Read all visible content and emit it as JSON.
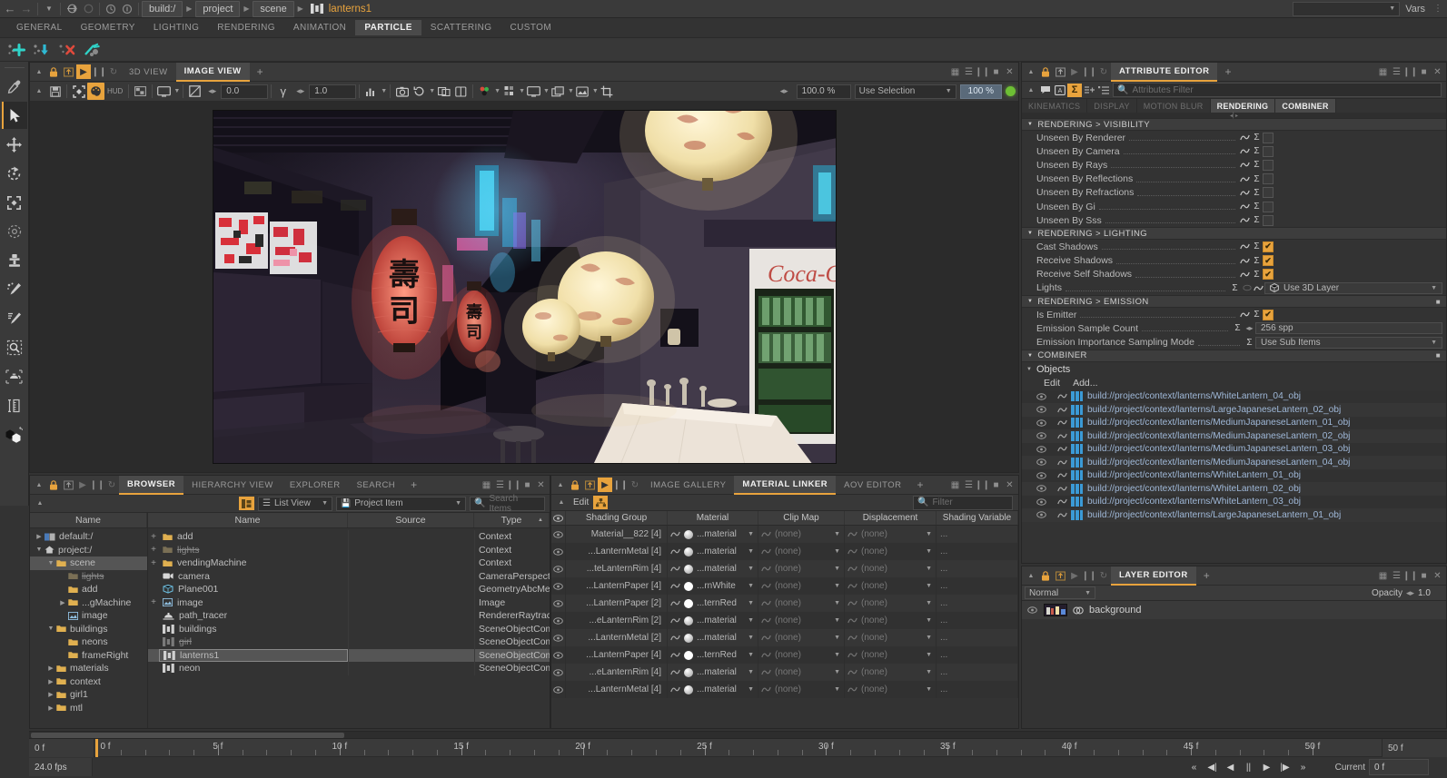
{
  "topbar": {
    "back_icon": "arrow-left-icon",
    "forward_icon": "arrow-right-icon",
    "history_icon": "chevron-down-icon",
    "crumbs": [
      {
        "label": "build:/"
      },
      {
        "label": "project"
      },
      {
        "label": "scene"
      }
    ],
    "active_item": "lanterns1",
    "vars_label": "Vars"
  },
  "menubar": {
    "items": [
      {
        "label": "GENERAL",
        "active": false
      },
      {
        "label": "GEOMETRY",
        "active": false
      },
      {
        "label": "LIGHTING",
        "active": false
      },
      {
        "label": "RENDERING",
        "active": false
      },
      {
        "label": "ANIMATION",
        "active": false
      },
      {
        "label": "PARTICLE",
        "active": true
      },
      {
        "label": "SCATTERING",
        "active": false
      },
      {
        "label": "CUSTOM",
        "active": false
      }
    ]
  },
  "particle_toolbar": {
    "buttons": [
      {
        "name": "add-particle-icon"
      },
      {
        "name": "import-particle-icon"
      },
      {
        "name": "delete-particle-icon"
      },
      {
        "name": "link-particle-icon"
      }
    ]
  },
  "left_tools": {
    "items": [
      {
        "name": "eyedropper-tool",
        "selected": false
      },
      {
        "name": "select-arrow-tool",
        "selected": true
      },
      {
        "name": "move-tool",
        "selected": false
      },
      {
        "name": "rotate-tool",
        "selected": false
      },
      {
        "name": "scale-tool",
        "selected": false
      },
      {
        "name": "soft-select-tool",
        "selected": false
      },
      {
        "name": "clone-stamp-tool",
        "selected": false
      },
      {
        "name": "particle-brush-tool",
        "selected": false
      },
      {
        "name": "paint-brush-tool",
        "selected": false
      },
      {
        "name": "region-render-tool",
        "selected": false
      },
      {
        "name": "teapot-primitive-tool",
        "selected": false
      },
      {
        "name": "measure-tool",
        "selected": false
      },
      {
        "name": "color-swatch-tool",
        "selected": false
      }
    ]
  },
  "viewport": {
    "tabs": [
      {
        "label": "3D VIEW",
        "active": false
      },
      {
        "label": "IMAGE VIEW",
        "active": true
      }
    ],
    "add_tab": "+",
    "toolbar": {
      "hud_label": "HUD",
      "exposure_value": "0.0",
      "gamma_value": "1.0",
      "zoom_value": "100.0 %",
      "selection_mode": "Use Selection",
      "zoom_badge": "100 %"
    },
    "scene_description": "Night alley 3D render with red sushi lanterns and white paper lanterns"
  },
  "browser": {
    "tabs": [
      {
        "label": "BROWSER",
        "active": true
      },
      {
        "label": "HIERARCHY VIEW",
        "active": false
      },
      {
        "label": "EXPLORER",
        "active": false
      },
      {
        "label": "SEARCH",
        "active": false
      }
    ],
    "add_tab": "+",
    "view_mode": "List View",
    "filter_mode": "Project Item",
    "search_placeholder": "Search Items",
    "tree_header": "Name",
    "tree": [
      {
        "label": "default:/",
        "depth": 0,
        "twisty": "▶",
        "icon": "book-icon",
        "selected": false,
        "disabled": false
      },
      {
        "label": "project:/",
        "depth": 0,
        "twisty": "▼",
        "icon": "home-icon",
        "selected": false,
        "disabled": false
      },
      {
        "label": "scene",
        "depth": 1,
        "twisty": "▼",
        "icon": "folder-icon",
        "selected": true,
        "disabled": false
      },
      {
        "label": "lights",
        "depth": 2,
        "twisty": "",
        "icon": "folder-icon",
        "selected": false,
        "disabled": true
      },
      {
        "label": "add",
        "depth": 2,
        "twisty": "",
        "icon": "folder-icon",
        "selected": false,
        "disabled": false
      },
      {
        "label": "...gMachine",
        "depth": 2,
        "twisty": "▶",
        "icon": "folder-icon",
        "selected": false,
        "disabled": false
      },
      {
        "label": "image",
        "depth": 2,
        "twisty": "",
        "icon": "image-icon",
        "selected": false,
        "disabled": false
      },
      {
        "label": "buildings",
        "depth": 1,
        "twisty": "▼",
        "icon": "folder-icon",
        "selected": false,
        "disabled": false
      },
      {
        "label": "neons",
        "depth": 2,
        "twisty": "",
        "icon": "folder-icon",
        "selected": false,
        "disabled": false
      },
      {
        "label": "frameRight",
        "depth": 2,
        "twisty": "",
        "icon": "folder-icon",
        "selected": false,
        "disabled": false
      },
      {
        "label": "materials",
        "depth": 1,
        "twisty": "▶",
        "icon": "folder-icon",
        "selected": false,
        "disabled": false
      },
      {
        "label": "context",
        "depth": 1,
        "twisty": "▶",
        "icon": "folder-icon",
        "selected": false,
        "disabled": false
      },
      {
        "label": "girl1",
        "depth": 1,
        "twisty": "▶",
        "icon": "folder-icon",
        "selected": false,
        "disabled": false
      },
      {
        "label": "mtl",
        "depth": 1,
        "twisty": "▶",
        "icon": "folder-icon",
        "selected": false,
        "disabled": false
      }
    ],
    "list_headers": [
      "Name",
      "Source",
      "Type"
    ],
    "list": [
      {
        "expand": "+",
        "name": "add",
        "icon": "folder-icon",
        "source": "",
        "type": "Context",
        "selected": false,
        "disabled": false
      },
      {
        "expand": "+",
        "name": "lights",
        "icon": "folder-icon",
        "source": "",
        "type": "Context",
        "selected": false,
        "disabled": true
      },
      {
        "expand": "+",
        "name": "vendingMachine",
        "icon": "folder-icon",
        "source": "",
        "type": "Context",
        "selected": false,
        "disabled": false
      },
      {
        "expand": "",
        "name": "camera",
        "icon": "camera-icon",
        "source": "",
        "type": "CameraPerspective",
        "selected": false,
        "disabled": false
      },
      {
        "expand": "",
        "name": "Plane001",
        "icon": "mesh-icon",
        "source": "",
        "type": "GeometryAbcMesh",
        "selected": false,
        "disabled": false
      },
      {
        "expand": "+",
        "name": "image",
        "icon": "image-icon",
        "source": "",
        "type": "Image",
        "selected": false,
        "disabled": false
      },
      {
        "expand": "",
        "name": "path_tracer",
        "icon": "renderer-icon",
        "source": "",
        "type": "RendererRaytracer",
        "selected": false,
        "disabled": false
      },
      {
        "expand": "",
        "name": "buildings",
        "icon": "sceneobject-icon",
        "source": "",
        "type": "SceneObjectComb",
        "selected": false,
        "disabled": false
      },
      {
        "expand": "",
        "name": "girl",
        "icon": "sceneobject-icon",
        "source": "",
        "type": "SceneObjectComb",
        "selected": false,
        "disabled": true
      },
      {
        "expand": "",
        "name": "lanterns1",
        "icon": "sceneobject-icon",
        "source": "",
        "type": "SceneObjectComb",
        "selected": true,
        "disabled": false
      },
      {
        "expand": "",
        "name": "neon",
        "icon": "sceneobject-icon",
        "source": "",
        "type": "SceneObjectComb",
        "selected": false,
        "disabled": false
      }
    ]
  },
  "material_linker": {
    "tabs": [
      {
        "label": "IMAGE GALLERY",
        "active": false
      },
      {
        "label": "MATERIAL LINKER",
        "active": true
      },
      {
        "label": "AOV EDITOR",
        "active": false
      }
    ],
    "add_tab": "+",
    "edit_label": "Edit",
    "filter_placeholder": "Filter",
    "headers": [
      "Shading Group",
      "Material",
      "Clip Map",
      "Displacement",
      "Shading Variable"
    ],
    "rows": [
      {
        "group": "Material__822 [4]",
        "material": "...material",
        "swatch": "#9a9a9a",
        "clip_map": "(none)",
        "displacement": "(none)",
        "shading_variable": "..."
      },
      {
        "group": "...LanternMetal [4]",
        "material": "...material",
        "swatch": "#9a9a9a",
        "clip_map": "(none)",
        "displacement": "(none)",
        "shading_variable": "..."
      },
      {
        "group": "...teLanternRim [4]",
        "material": "...material",
        "swatch": "#9a9a9a",
        "clip_map": "(none)",
        "displacement": "(none)",
        "shading_variable": "..."
      },
      {
        "group": "...LanternPaper [4]",
        "material": "...rnWhite",
        "swatch": "#ffffff",
        "clip_map": "(none)",
        "displacement": "(none)",
        "shading_variable": "..."
      },
      {
        "group": "...LanternPaper [2]",
        "material": "...ternRed",
        "swatch": "#ffffff",
        "clip_map": "(none)",
        "displacement": "(none)",
        "shading_variable": "..."
      },
      {
        "group": "...eLanternRim [2]",
        "material": "...material",
        "swatch": "#9a9a9a",
        "clip_map": "(none)",
        "displacement": "(none)",
        "shading_variable": "..."
      },
      {
        "group": "...LanternMetal [2]",
        "material": "...material",
        "swatch": "#9a9a9a",
        "clip_map": "(none)",
        "displacement": "(none)",
        "shading_variable": "..."
      },
      {
        "group": "...LanternPaper [4]",
        "material": "...ternRed",
        "swatch": "#ffffff",
        "clip_map": "(none)",
        "displacement": "(none)",
        "shading_variable": "..."
      },
      {
        "group": "...eLanternRim [4]",
        "material": "...material",
        "swatch": "#9a9a9a",
        "clip_map": "(none)",
        "displacement": "(none)",
        "shading_variable": "..."
      },
      {
        "group": "...LanternMetal [4]",
        "material": "...material",
        "swatch": "#9a9a9a",
        "clip_map": "(none)",
        "displacement": "(none)",
        "shading_variable": "..."
      }
    ]
  },
  "attribute_editor": {
    "tabs": [
      {
        "label": "ATTRIBUTE EDITOR",
        "active": true
      }
    ],
    "add_tab": "+",
    "filter_placeholder": "Attributes Filter",
    "subtabs": [
      {
        "label": "KINEMATICS",
        "active": false
      },
      {
        "label": "DISPLAY",
        "active": false
      },
      {
        "label": "MOTION BLUR",
        "active": false
      },
      {
        "label": "RENDERING",
        "active": true
      },
      {
        "label": "COMBINER",
        "active": true
      }
    ],
    "sections": [
      {
        "title": "RENDERING > VISIBILITY",
        "rows": [
          {
            "label": "Unseen By Renderer",
            "kind": "check",
            "checked": false
          },
          {
            "label": "Unseen By Camera",
            "kind": "check",
            "checked": false
          },
          {
            "label": "Unseen By Rays",
            "kind": "check",
            "checked": false
          },
          {
            "label": "Unseen By Reflections",
            "kind": "check",
            "checked": false
          },
          {
            "label": "Unseen By Refractions",
            "kind": "check",
            "checked": false
          },
          {
            "label": "Unseen By Gi",
            "kind": "check",
            "checked": false
          },
          {
            "label": "Unseen By Sss",
            "kind": "check",
            "checked": false
          }
        ]
      },
      {
        "title": "RENDERING > LIGHTING",
        "rows": [
          {
            "label": "Cast Shadows",
            "kind": "check",
            "checked": true
          },
          {
            "label": "Receive Shadows",
            "kind": "check",
            "checked": true
          },
          {
            "label": "Receive Self Shadows",
            "kind": "check",
            "checked": true
          },
          {
            "label": "Lights",
            "kind": "dropdown",
            "value": "Use 3D Layer"
          }
        ]
      },
      {
        "title": "RENDERING > EMISSION",
        "rows": [
          {
            "label": "Is Emitter",
            "kind": "check",
            "checked": true
          },
          {
            "label": "Emission Sample Count",
            "kind": "numeric",
            "value": "256 spp"
          },
          {
            "label": "Emission Importance Sampling Mode",
            "kind": "dropdown",
            "value": "Use Sub Items"
          }
        ]
      }
    ],
    "combiner": {
      "title": "COMBINER",
      "objects_label": "Objects",
      "edit_label": "Edit",
      "add_label": "Add...",
      "objects": [
        "build://project/context/lanterns/WhiteLantern_04_obj",
        "build://project/context/lanterns/LargeJapaneseLantern_02_obj",
        "build://project/context/lanterns/MediumJapaneseLantern_01_obj",
        "build://project/context/lanterns/MediumJapaneseLantern_02_obj",
        "build://project/context/lanterns/MediumJapaneseLantern_03_obj",
        "build://project/context/lanterns/MediumJapaneseLantern_04_obj",
        "build://project/context/lanterns/WhiteLantern_01_obj",
        "build://project/context/lanterns/WhiteLantern_02_obj",
        "build://project/context/lanterns/WhiteLantern_03_obj",
        "build://project/context/lanterns/LargeJapaneseLantern_01_obj"
      ]
    }
  },
  "layer_editor": {
    "tabs": [
      {
        "label": "LAYER EDITOR",
        "active": true
      }
    ],
    "add_tab": "+",
    "blend_mode": "Normal",
    "opacity_label": "Opacity",
    "opacity_value": "1.0",
    "layers": [
      {
        "name": "background",
        "visible": true
      }
    ]
  },
  "timeline": {
    "start_label": "0 f",
    "fps_label": "24.0 fps",
    "end_label": "50 f",
    "current_label": "Current",
    "current_value": "0 f",
    "ticks": [
      {
        "label": "0 f",
        "frame": 0
      },
      {
        "label": "5 f",
        "frame": 5
      },
      {
        "label": "10 f",
        "frame": 10
      },
      {
        "label": "15 f",
        "frame": 15
      },
      {
        "label": "20 f",
        "frame": 20
      },
      {
        "label": "25 f",
        "frame": 25
      },
      {
        "label": "30 f",
        "frame": 30
      },
      {
        "label": "35 f",
        "frame": 35
      },
      {
        "label": "40 f",
        "frame": 40
      },
      {
        "label": "45 f",
        "frame": 45
      },
      {
        "label": "50 f",
        "frame": 50
      }
    ],
    "playhead_frame": 0,
    "transport": [
      {
        "name": "go-to-start-button",
        "glyph": "«"
      },
      {
        "name": "step-back-key-button",
        "glyph": "◀|"
      },
      {
        "name": "step-back-button",
        "glyph": "◀"
      },
      {
        "name": "pause-button",
        "glyph": "||"
      },
      {
        "name": "play-button",
        "glyph": "▶"
      },
      {
        "name": "step-forward-key-button",
        "glyph": "|▶"
      },
      {
        "name": "go-to-end-button",
        "glyph": "»"
      }
    ]
  },
  "colors": {
    "accent": "#e8a33d",
    "panel_bg": "#333333",
    "toolbar_bg": "#3a3a3a",
    "selected_row": "#555555",
    "object_link": "#9fb8d8"
  }
}
